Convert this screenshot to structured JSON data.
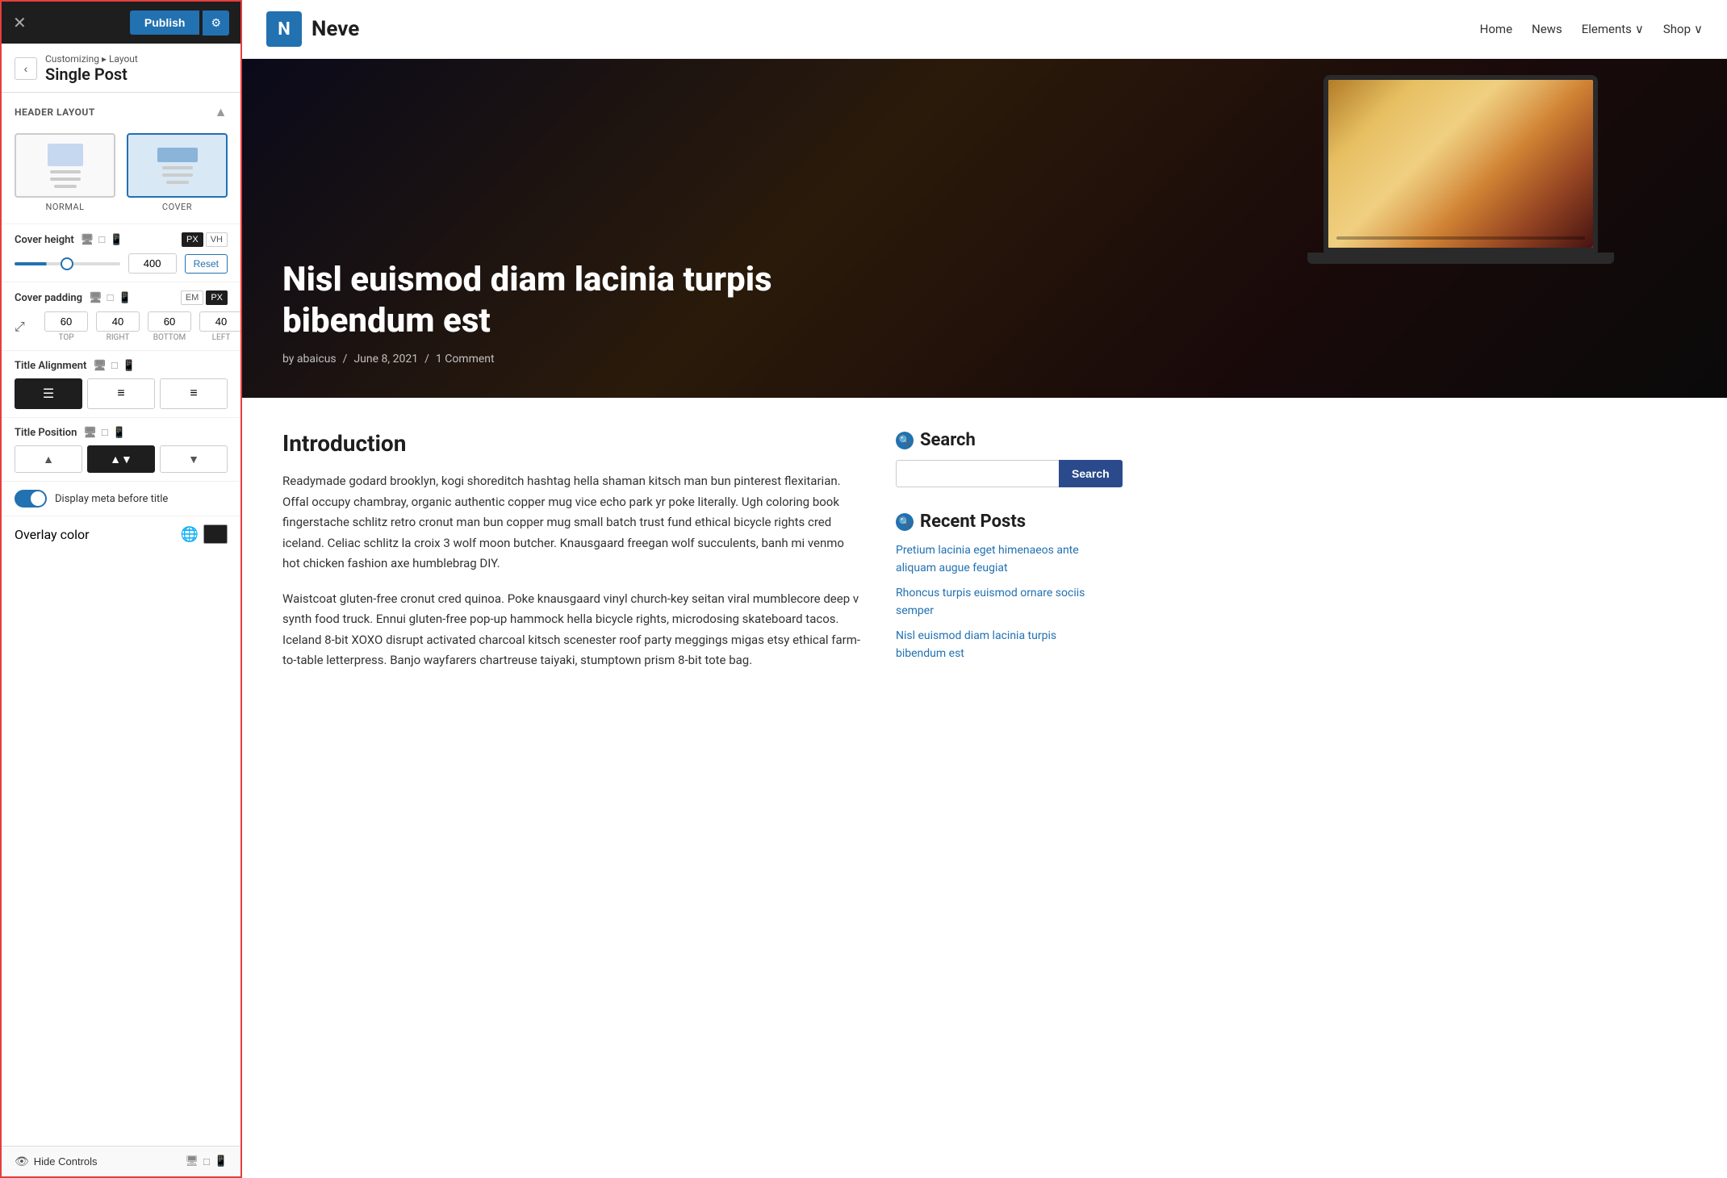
{
  "topbar": {
    "close_label": "✕",
    "publish_label": "Publish",
    "settings_icon": "⚙"
  },
  "breadcrumb": {
    "parent": "Customizing",
    "separator": "▸",
    "child": "Layout",
    "title": "Single Post",
    "back_icon": "‹"
  },
  "panel": {
    "header_layout_label": "HEADER LAYOUT",
    "collapse_icon": "▲",
    "normal_label": "NORMAL",
    "cover_label": "COVER",
    "cover_height_label": "Cover height",
    "cover_height_value": "400",
    "reset_label": "Reset",
    "unit_px": "PX",
    "unit_vh": "VH",
    "cover_padding_label": "Cover padding",
    "unit_em": "EM",
    "padding_top": "60",
    "padding_right": "40",
    "padding_bottom": "60",
    "padding_left": "40",
    "label_top": "TOP",
    "label_right": "RIGHT",
    "label_bottom": "BOTTOM",
    "label_left": "LEFT",
    "title_alignment_label": "Title Alignment",
    "title_position_label": "Title Position",
    "display_meta_label": "Display meta before title",
    "overlay_color_label": "Overlay color",
    "hide_controls_label": "Hide Controls"
  },
  "site": {
    "logo_letter": "N",
    "site_name": "Neve",
    "nav_home": "Home",
    "nav_news": "News",
    "nav_elements": "Elements",
    "nav_elements_arrow": "∨",
    "nav_shop": "Shop",
    "nav_shop_arrow": "∨"
  },
  "hero": {
    "title": "Nisl euismod diam lacinia turpis bibendum est",
    "meta_by": "by abaicus",
    "meta_sep1": "/",
    "meta_date": "June 8, 2021",
    "meta_sep2": "/",
    "meta_comments": "1 Comment"
  },
  "article": {
    "title": "Introduction",
    "para1": "Readymade godard brooklyn, kogi shoreditch hashtag hella shaman kitsch man bun pinterest flexitarian. Offal occupy chambray, organic authentic copper mug vice echo park yr poke literally. Ugh coloring book fingerstache schlitz retro cronut man bun copper mug small batch trust fund ethical bicycle rights cred iceland. Celiac schlitz la croix 3 wolf moon butcher. Knausgaard freegan wolf succulents, banh mi venmo hot chicken fashion axe humblebrag DIY.",
    "para2": "Waistcoat gluten-free cronut cred quinoa. Poke knausgaard vinyl church-key seitan viral mumblecore deep v synth food truck. Ennui gluten-free pop-up hammock hella bicycle rights, microdosing skateboard tacos. Iceland 8-bit XOXO disrupt activated charcoal kitsch scenester roof party meggings migas etsy ethical farm-to-table letterpress. Banjo wayfarers chartreuse taiyaki, stumptown prism 8-bit tote bag."
  },
  "sidebar": {
    "search_title": "Search",
    "search_placeholder": "",
    "search_btn_label": "Search",
    "recent_posts_title": "Recent Posts",
    "post1": "Pretium lacinia eget himenaeos ante aliquam augue feugiat",
    "post2": "Rhoncus turpis euismod ornare sociis semper",
    "post3": "Nisl euismod diam lacinia turpis bibendum est"
  }
}
